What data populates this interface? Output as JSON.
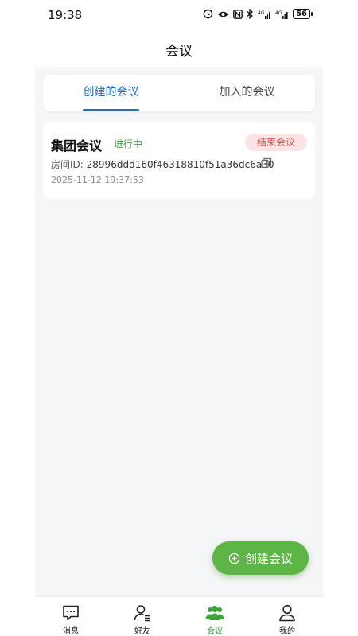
{
  "status_bar": {
    "time": "19:38",
    "battery": "56",
    "icons": [
      "alarm-icon",
      "eye-icon",
      "nfc-icon",
      "bluetooth-icon",
      "signal-4g-icon",
      "signal-4g-icon"
    ]
  },
  "header": {
    "title": "会议"
  },
  "tabs": [
    {
      "label": "创建的会议",
      "active": true
    },
    {
      "label": "加入的会议",
      "active": false
    }
  ],
  "meetings": [
    {
      "name": "集团会议",
      "status": "进行中",
      "end_label": "结束会议",
      "room_id_label": "房间ID:",
      "room_id": "28996ddd160f46318810f51a36dc6a30",
      "time": "2025-11-12 19:37:53"
    }
  ],
  "fab": {
    "label": "创建会议",
    "icon": "plus-circle-icon"
  },
  "bottom_nav": [
    {
      "label": "消息",
      "icon": "message-icon",
      "active": false
    },
    {
      "label": "好友",
      "icon": "friends-icon",
      "active": false
    },
    {
      "label": "会议",
      "icon": "meeting-icon",
      "active": true
    },
    {
      "label": "我的",
      "icon": "profile-icon",
      "active": false
    }
  ],
  "colors": {
    "accent_blue": "#1a6fc9",
    "accent_green": "#5cb545",
    "status_green": "#3fa33d",
    "danger_red": "#d9534f",
    "danger_bg": "#fde4e4",
    "background": "#f5f6f7"
  }
}
